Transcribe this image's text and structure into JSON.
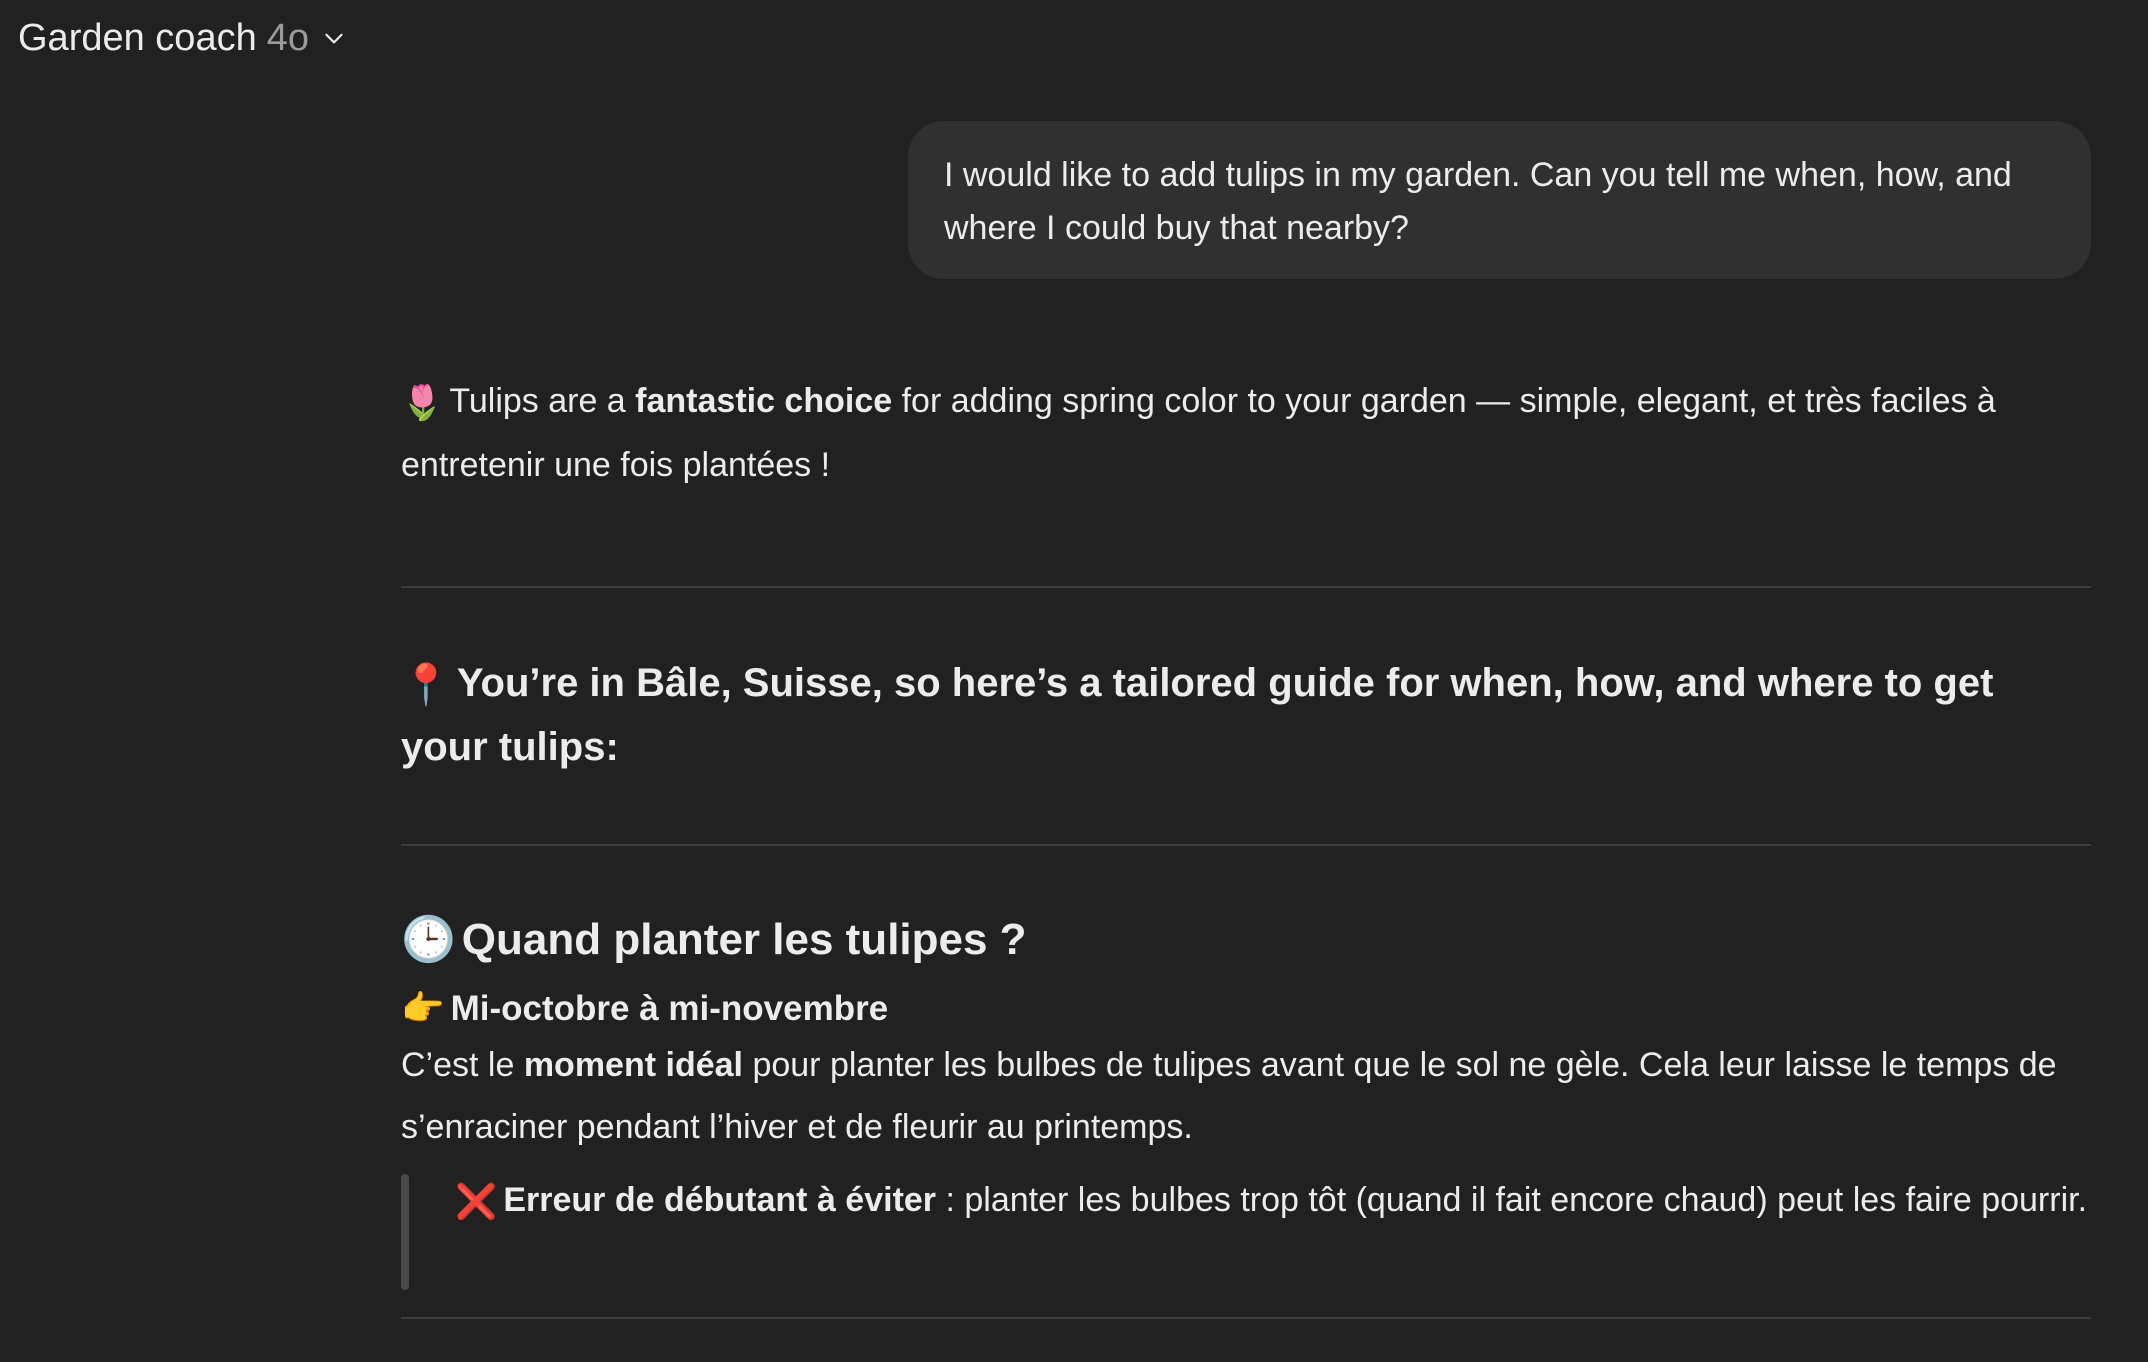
{
  "header": {
    "title": "Garden coach",
    "model": "4o"
  },
  "user_message": {
    "text": "I would like to add tulips in my garden. Can you tell me when, how, and where I could buy that nearby?"
  },
  "assistant": {
    "intro": {
      "emoji": "🌷",
      "part1": "Tulips are a ",
      "bold": "fantastic choice",
      "part2": " for adding spring color to your garden — simple, elegant, et très faciles à entretenir une fois plantées !"
    },
    "location_heading": {
      "emoji": "📍",
      "text": "You’re in Bâle, Suisse, so here’s a tailored guide for when, how, and where to get your tulips:"
    },
    "section_when": {
      "emoji": "🕒",
      "title": "Quand planter les tulipes ?",
      "subtitle_emoji": "👉",
      "subtitle": "Mi-octobre à mi-novembre",
      "body_part1": "C’est le ",
      "body_bold": "moment idéal",
      "body_part2": " pour planter les bulbes de tulipes avant que le sol ne gèle. Cela leur laisse le temps de s’enraciner pendant l’hiver et de fleurir au printemps.",
      "warning_emoji": "❌",
      "warning_bold": "Erreur de débutant à éviter",
      "warning_text": " : planter les bulbes trop tôt (quand il fait encore chaud) peut les faire pourrir."
    }
  },
  "colors": {
    "background": "#212121",
    "user_bubble": "#303030",
    "text": "#ececec",
    "muted": "#9b9b9b",
    "divider": "#3d3d3d",
    "quote_bar": "#4a4a4a"
  }
}
